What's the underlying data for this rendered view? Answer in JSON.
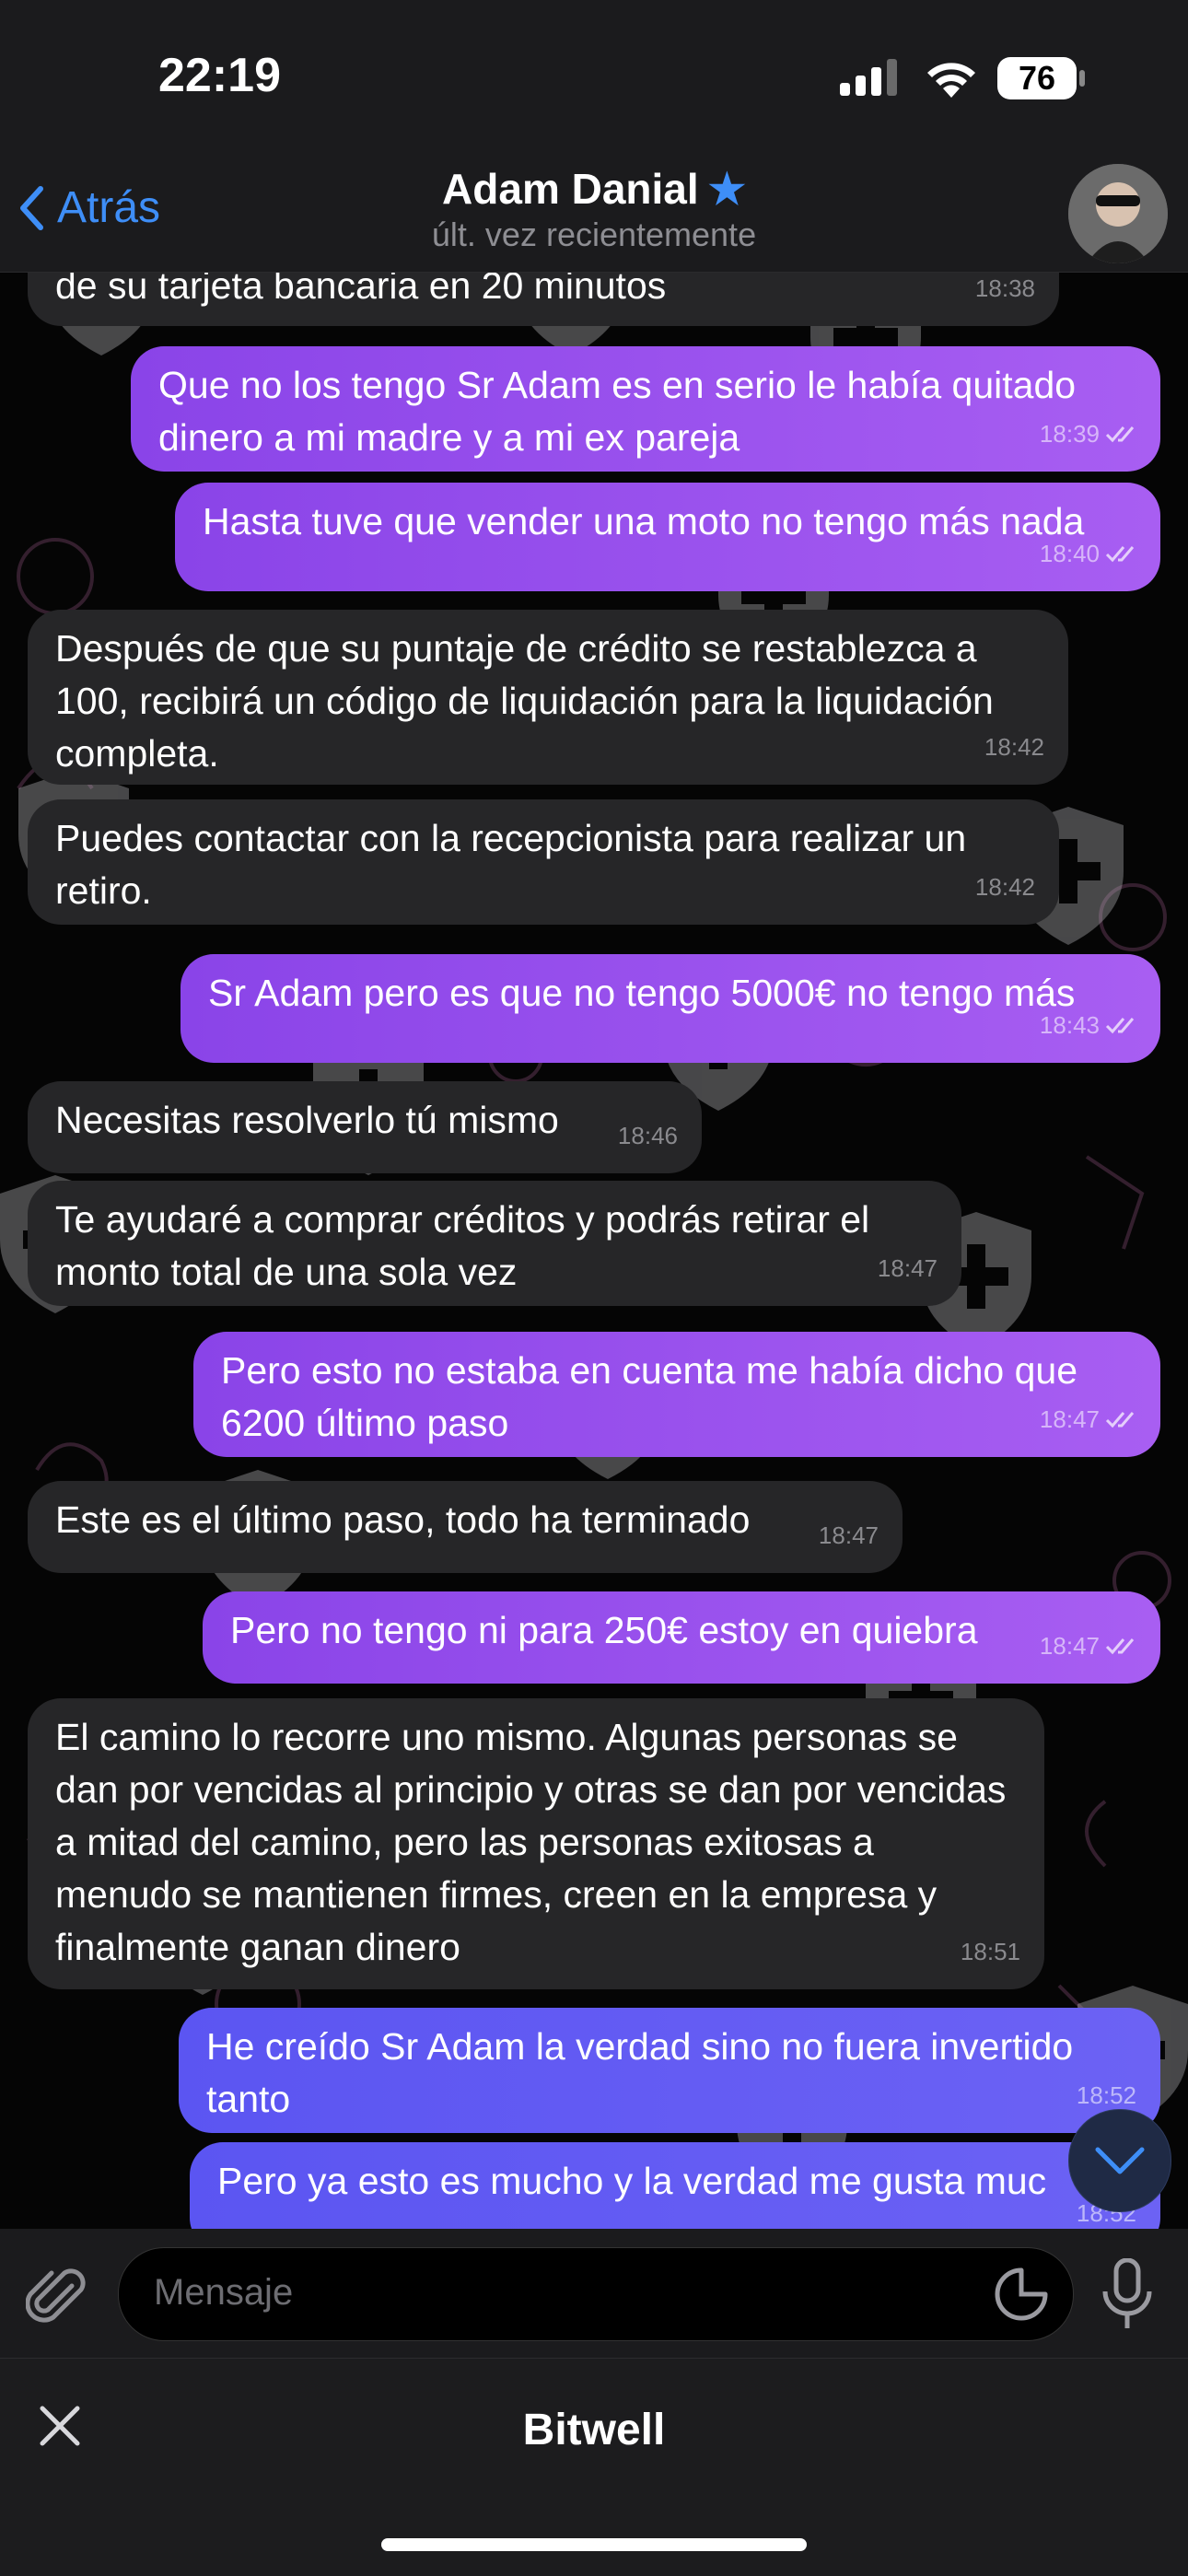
{
  "status_bar": {
    "time": "22:19",
    "battery": "76"
  },
  "nav": {
    "back_label": "Atrás",
    "title": "Adam Danial",
    "subtitle": "últ. vez recientemente"
  },
  "messages": [
    {
      "text": "de su tarjeta bancaria en 20 minutos",
      "time": "18:38",
      "dir": "in"
    },
    {
      "text": "Que no los tengo Sr Adam es en serio le había quitado dinero a mi madre y a mi ex pareja",
      "time": "18:39",
      "dir": "out"
    },
    {
      "text": "Hasta tuve que vender una moto no tengo más nada",
      "time": "18:40",
      "dir": "out"
    },
    {
      "text": "Después de que su puntaje de crédito se restablezca a 100, recibirá un código de liquidación para la liquidación completa.",
      "time": "18:42",
      "dir": "in"
    },
    {
      "text": "Puedes contactar con la recepcionista para realizar un retiro.",
      "time": "18:42",
      "dir": "in"
    },
    {
      "text": "Sr Adam pero es que no tengo 5000€ no tengo más",
      "time": "18:43",
      "dir": "out"
    },
    {
      "text": "Necesitas resolverlo tú mismo",
      "time": "18:46",
      "dir": "in"
    },
    {
      "text": "Te ayudaré a comprar créditos y podrás retirar el monto total de una sola vez",
      "time": "18:47",
      "dir": "in"
    },
    {
      "text": "Pero esto no estaba en cuenta me había dicho que 6200 último paso",
      "time": "18:47",
      "dir": "out"
    },
    {
      "text": "Este es el último paso, todo ha terminado",
      "time": "18:47",
      "dir": "in"
    },
    {
      "text": "Pero no tengo ni para 250€ estoy en quiebra",
      "time": "18:47",
      "dir": "out"
    },
    {
      "text": "El camino lo recorre uno mismo. Algunas personas se dan por vencidas al principio y otras se dan por vencidas a mitad del camino, pero las personas exitosas a menudo se mantienen firmes, creen en la empresa y finalmente ganan dinero",
      "time": "18:51",
      "dir": "in"
    },
    {
      "text": "He creído Sr Adam la verdad sino no fuera invertido tanto",
      "time": "18:52",
      "dir": "out"
    },
    {
      "text": "Pero ya esto es mucho y la verdad me gusta muc",
      "time": "18:52",
      "dir": "out"
    }
  ],
  "input": {
    "placeholder": "Mensaje"
  },
  "bottom_sheet": {
    "title": "Bitwell"
  },
  "colors": {
    "accent": "#3e8ef7",
    "outgoing_bubble": "#9a52ee",
    "outgoing_bubble_latest": "#6158f3",
    "incoming_bubble": "#262628"
  }
}
